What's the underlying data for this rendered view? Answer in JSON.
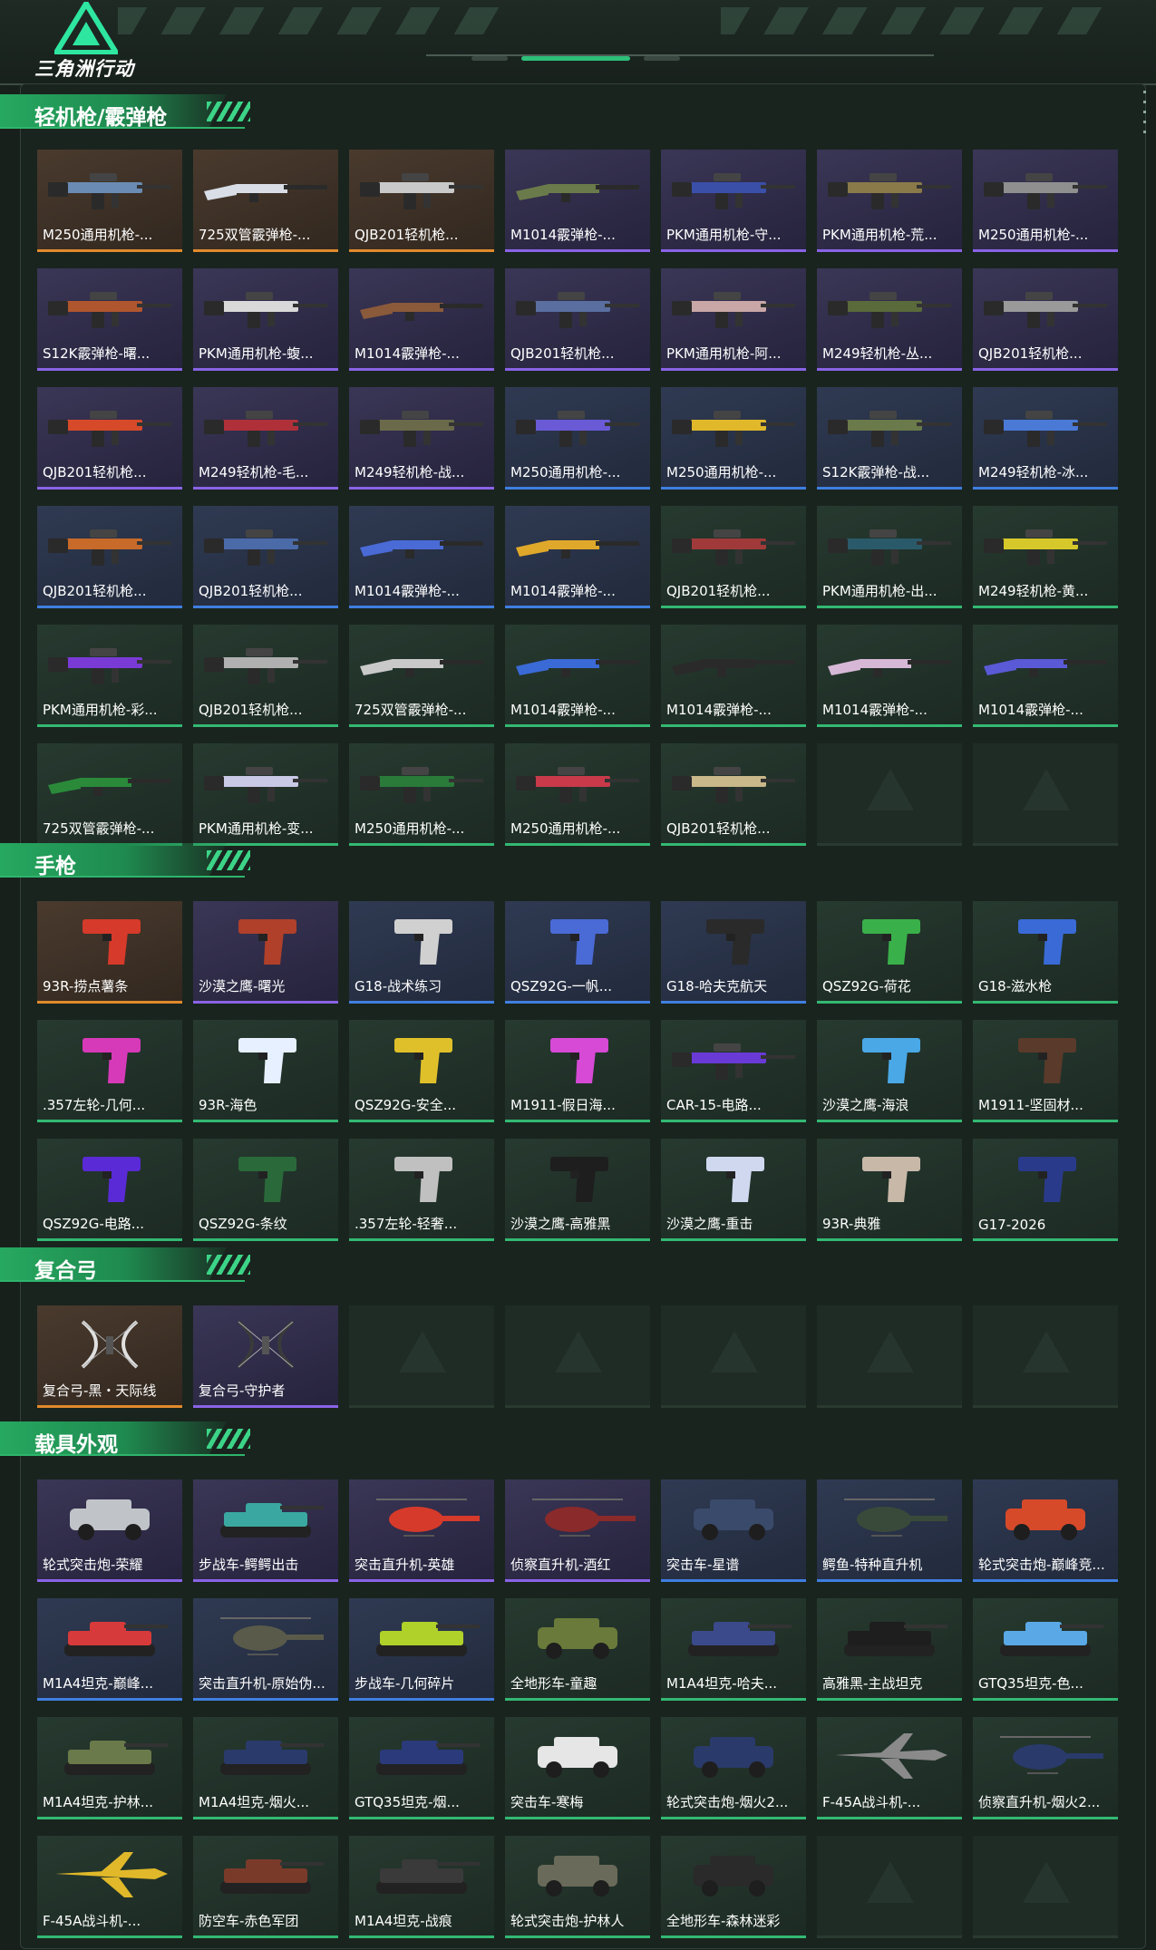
{
  "app": {
    "title": "三角洲行动"
  },
  "sections": [
    {
      "title": "轻机枪/霰弹枪",
      "items": [
        {
          "name": "M250通用机枪-...",
          "rarity": "orange",
          "kind": "rifle",
          "color": "#6a8bb3"
        },
        {
          "name": "725双管霰弹枪-...",
          "rarity": "orange",
          "kind": "shotgun",
          "color": "#d8dde6"
        },
        {
          "name": "QJB201轻机枪...",
          "rarity": "orange",
          "kind": "rifle",
          "color": "#c9c9c9"
        },
        {
          "name": "M1014霰弹枪-...",
          "rarity": "purple",
          "kind": "shotgun",
          "color": "#6b7a4a"
        },
        {
          "name": "PKM通用机枪-守...",
          "rarity": "purple",
          "kind": "rifle",
          "color": "#3a4fa8"
        },
        {
          "name": "PKM通用机枪-荒...",
          "rarity": "purple",
          "kind": "rifle",
          "color": "#8a7a4a"
        },
        {
          "name": "M250通用机枪-...",
          "rarity": "purple",
          "kind": "rifle",
          "color": "#8f8f8f"
        },
        {
          "name": "S12K霰弹枪-曙...",
          "rarity": "purple",
          "kind": "rifle",
          "color": "#b0562e"
        },
        {
          "name": "PKM通用机枪-蝮...",
          "rarity": "purple",
          "kind": "rifle",
          "color": "#d9d9d9"
        },
        {
          "name": "M1014霰弹枪-...",
          "rarity": "purple",
          "kind": "shotgun",
          "color": "#8a5a3a"
        },
        {
          "name": "QJB201轻机枪...",
          "rarity": "purple",
          "kind": "rifle",
          "color": "#5a6fa0"
        },
        {
          "name": "PKM通用机枪-阿...",
          "rarity": "purple",
          "kind": "rifle",
          "color": "#c9a7a7"
        },
        {
          "name": "M249轻机枪-丛...",
          "rarity": "purple",
          "kind": "rifle",
          "color": "#5a6a3a"
        },
        {
          "name": "QJB201轻机枪...",
          "rarity": "purple",
          "kind": "rifle",
          "color": "#9a9a9a"
        },
        {
          "name": "QJB201轻机枪...",
          "rarity": "purple",
          "kind": "rifle",
          "color": "#d64a2a"
        },
        {
          "name": "M249轻机枪-毛...",
          "rarity": "purple",
          "kind": "rifle",
          "color": "#b0303a"
        },
        {
          "name": "M249轻机枪-战...",
          "rarity": "purple",
          "kind": "rifle",
          "color": "#6a6a4a"
        },
        {
          "name": "M250通用机枪-...",
          "rarity": "blue",
          "kind": "rifle",
          "color": "#6a5ad6"
        },
        {
          "name": "M250通用机枪-...",
          "rarity": "blue",
          "kind": "rifle",
          "color": "#e0b82a"
        },
        {
          "name": "S12K霰弹枪-战...",
          "rarity": "blue",
          "kind": "rifle",
          "color": "#6a7a4a"
        },
        {
          "name": "M249轻机枪-冰...",
          "rarity": "blue",
          "kind": "rifle",
          "color": "#4a7ad6"
        },
        {
          "name": "QJB201轻机枪...",
          "rarity": "blue",
          "kind": "rifle",
          "color": "#c86a2a"
        },
        {
          "name": "QJB201轻机枪...",
          "rarity": "blue",
          "kind": "rifle",
          "color": "#4a6aa8"
        },
        {
          "name": "M1014霰弹枪-...",
          "rarity": "blue",
          "kind": "shotgun",
          "color": "#4a6ad6"
        },
        {
          "name": "M1014霰弹枪-...",
          "rarity": "blue",
          "kind": "shotgun",
          "color": "#e0a82a"
        },
        {
          "name": "QJB201轻机枪...",
          "rarity": "green",
          "kind": "rifle",
          "color": "#a03a3a"
        },
        {
          "name": "PKM通用机枪-出...",
          "rarity": "green",
          "kind": "rifle",
          "color": "#2a5a6a"
        },
        {
          "name": "M249轻机枪-黄...",
          "rarity": "green",
          "kind": "rifle",
          "color": "#d6c82a"
        },
        {
          "name": "PKM通用机枪-彩...",
          "rarity": "green",
          "kind": "rifle",
          "color": "#7a3ad6"
        },
        {
          "name": "QJB201轻机枪...",
          "rarity": "green",
          "kind": "rifle",
          "color": "#b0b0b0"
        },
        {
          "name": "725双管霰弹枪-...",
          "rarity": "green",
          "kind": "shotgun",
          "color": "#c9c9c9"
        },
        {
          "name": "M1014霰弹枪-...",
          "rarity": "green",
          "kind": "shotgun",
          "color": "#3a6ad6"
        },
        {
          "name": "M1014霰弹枪-...",
          "rarity": "green",
          "kind": "shotgun",
          "color": "#2a2a2a"
        },
        {
          "name": "M1014霰弹枪-...",
          "rarity": "green",
          "kind": "shotgun",
          "color": "#d6b8d6"
        },
        {
          "name": "M1014霰弹枪-...",
          "rarity": "green",
          "kind": "shotgun",
          "color": "#5a5ad6"
        },
        {
          "name": "725双管霰弹枪-...",
          "rarity": "green",
          "kind": "shotgun",
          "color": "#2a8a3a"
        },
        {
          "name": "PKM通用机枪-变...",
          "rarity": "green",
          "kind": "rifle",
          "color": "#c9c9e6"
        },
        {
          "name": "M250通用机枪-...",
          "rarity": "green",
          "kind": "rifle",
          "color": "#2a7a3a"
        },
        {
          "name": "M250通用机枪-...",
          "rarity": "green",
          "kind": "rifle",
          "color": "#c83a4a"
        },
        {
          "name": "QJB201轻机枪...",
          "rarity": "green",
          "kind": "rifle",
          "color": "#c9b88a"
        },
        {
          "name": "",
          "rarity": "empty",
          "kind": "none",
          "color": ""
        },
        {
          "name": "",
          "rarity": "empty",
          "kind": "none",
          "color": ""
        }
      ]
    },
    {
      "title": "手枪",
      "items": [
        {
          "name": "93R-捞点薯条",
          "rarity": "orange",
          "kind": "pistol",
          "color": "#d63a2a"
        },
        {
          "name": "沙漠之鹰-曙光",
          "rarity": "purple",
          "kind": "pistol",
          "color": "#b0402a"
        },
        {
          "name": "G18-战术练习",
          "rarity": "blue",
          "kind": "pistol",
          "color": "#d0d0d0"
        },
        {
          "name": "QSZ92G-一帆...",
          "rarity": "blue",
          "kind": "pistol",
          "color": "#4a6ad6"
        },
        {
          "name": "G18-哈夫克航天",
          "rarity": "blue",
          "kind": "pistol",
          "color": "#2a2a2a"
        },
        {
          "name": "QSZ92G-荷花",
          "rarity": "green",
          "kind": "pistol",
          "color": "#3ab04a"
        },
        {
          "name": "G18-滋水枪",
          "rarity": "green",
          "kind": "pistol",
          "color": "#3a6ad6"
        },
        {
          "name": ".357左轮-几何...",
          "rarity": "green",
          "kind": "pistol",
          "color": "#d63ab8"
        },
        {
          "name": "93R-海色",
          "rarity": "green",
          "kind": "pistol",
          "color": "#e6f0ff"
        },
        {
          "name": "QSZ92G-安全...",
          "rarity": "green",
          "kind": "pistol",
          "color": "#e0c02a"
        },
        {
          "name": "M1911-假日海...",
          "rarity": "green",
          "kind": "pistol",
          "color": "#d64ad6"
        },
        {
          "name": "CAR-15-电路...",
          "rarity": "green",
          "kind": "rifle",
          "color": "#6a3ad6"
        },
        {
          "name": "沙漠之鹰-海浪",
          "rarity": "green",
          "kind": "pistol",
          "color": "#4aa8e6"
        },
        {
          "name": "M1911-坚固材...",
          "rarity": "green",
          "kind": "pistol",
          "color": "#5a3a2a"
        },
        {
          "name": "QSZ92G-电路...",
          "rarity": "green",
          "kind": "pistol",
          "color": "#5a2ad6"
        },
        {
          "name": "QSZ92G-条纹",
          "rarity": "green",
          "kind": "pistol",
          "color": "#2a6a3a"
        },
        {
          "name": ".357左轮-轻奢...",
          "rarity": "green",
          "kind": "pistol",
          "color": "#c0c0c0"
        },
        {
          "name": "沙漠之鹰-高雅黑",
          "rarity": "green",
          "kind": "pistol",
          "color": "#1e1e1e"
        },
        {
          "name": "沙漠之鹰-重击",
          "rarity": "green",
          "kind": "pistol",
          "color": "#d0d8f0"
        },
        {
          "name": "93R-典雅",
          "rarity": "green",
          "kind": "pistol",
          "color": "#c8b8a8"
        },
        {
          "name": "G17-2026",
          "rarity": "green",
          "kind": "pistol",
          "color": "#2a3a8a"
        }
      ]
    },
    {
      "title": "复合弓",
      "items": [
        {
          "name": "复合弓-黑・天际线",
          "rarity": "orange",
          "kind": "bow",
          "color": "#e0e0e0"
        },
        {
          "name": "复合弓-守护者",
          "rarity": "purple",
          "kind": "bow",
          "color": "#3a3a3a"
        },
        {
          "name": "",
          "rarity": "empty",
          "kind": "none",
          "color": ""
        },
        {
          "name": "",
          "rarity": "empty",
          "kind": "none",
          "color": ""
        },
        {
          "name": "",
          "rarity": "empty",
          "kind": "none",
          "color": ""
        },
        {
          "name": "",
          "rarity": "empty",
          "kind": "none",
          "color": ""
        },
        {
          "name": "",
          "rarity": "empty",
          "kind": "none",
          "color": ""
        }
      ]
    },
    {
      "title": "载具外观",
      "items": [
        {
          "name": "轮式突击炮-荣耀",
          "rarity": "purple",
          "kind": "car",
          "color": "#c0c4c8"
        },
        {
          "name": "步战车-鳄鳄出击",
          "rarity": "purple",
          "kind": "tank",
          "color": "#3aa8a0"
        },
        {
          "name": "突击直升机-英雄",
          "rarity": "purple",
          "kind": "heli",
          "color": "#d63a2a"
        },
        {
          "name": "侦察直升机-酒红",
          "rarity": "purple",
          "kind": "heli",
          "color": "#8a2a2a"
        },
        {
          "name": "突击车-星谱",
          "rarity": "blue",
          "kind": "car",
          "color": "#3a4a6a"
        },
        {
          "name": "鳄鱼-特种直升机",
          "rarity": "blue",
          "kind": "heli",
          "color": "#3a4a3a"
        },
        {
          "name": "轮式突击炮-巅峰竞...",
          "rarity": "blue",
          "kind": "car",
          "color": "#d64a2a"
        },
        {
          "name": "M1A4坦克-巅峰...",
          "rarity": "blue",
          "kind": "tank",
          "color": "#d63a3a"
        },
        {
          "name": "突击直升机-原始伪...",
          "rarity": "blue",
          "kind": "heli",
          "color": "#5a5a4a"
        },
        {
          "name": "步战车-几何碎片",
          "rarity": "blue",
          "kind": "tank",
          "color": "#b0d02a"
        },
        {
          "name": "全地形车-童趣",
          "rarity": "green",
          "kind": "car",
          "color": "#6a7a3a"
        },
        {
          "name": "M1A4坦克-哈夫...",
          "rarity": "green",
          "kind": "tank",
          "color": "#3a4a8a"
        },
        {
          "name": "高雅黑-主战坦克",
          "rarity": "green",
          "kind": "tank",
          "color": "#1e1e1e"
        },
        {
          "name": "GTQ35坦克-色...",
          "rarity": "green",
          "kind": "tank",
          "color": "#5aa8e6"
        },
        {
          "name": "M1A4坦克-护林...",
          "rarity": "green",
          "kind": "tank",
          "color": "#6a7a4a"
        },
        {
          "name": "M1A4坦克-烟火...",
          "rarity": "green",
          "kind": "tank",
          "color": "#2a3a6a"
        },
        {
          "name": "GTQ35坦克-烟...",
          "rarity": "green",
          "kind": "tank",
          "color": "#2a3a7a"
        },
        {
          "name": "突击车-寒梅",
          "rarity": "green",
          "kind": "car",
          "color": "#e6e6e6"
        },
        {
          "name": "轮式突击炮-烟火2...",
          "rarity": "green",
          "kind": "car",
          "color": "#2a3a6a"
        },
        {
          "name": "F-45A战斗机-...",
          "rarity": "green",
          "kind": "jet",
          "color": "#8a8a8a"
        },
        {
          "name": "侦察直升机-烟火2...",
          "rarity": "green",
          "kind": "heli",
          "color": "#2a3a6a"
        },
        {
          "name": "F-45A战斗机-...",
          "rarity": "green",
          "kind": "jet",
          "color": "#e0b82a"
        },
        {
          "name": "防空车-赤色军团",
          "rarity": "green",
          "kind": "tank",
          "color": "#7a3a2a"
        },
        {
          "name": "M1A4坦克-战痕",
          "rarity": "green",
          "kind": "tank",
          "color": "#3a3a3a"
        },
        {
          "name": "轮式突击炮-护林人",
          "rarity": "green",
          "kind": "car",
          "color": "#6a6a5a"
        },
        {
          "name": "全地形车-森林迷彩",
          "rarity": "green",
          "kind": "car",
          "color": "#2a2a2a"
        },
        {
          "name": "",
          "rarity": "empty",
          "kind": "none",
          "color": ""
        },
        {
          "name": "",
          "rarity": "empty",
          "kind": "none",
          "color": ""
        }
      ]
    }
  ]
}
